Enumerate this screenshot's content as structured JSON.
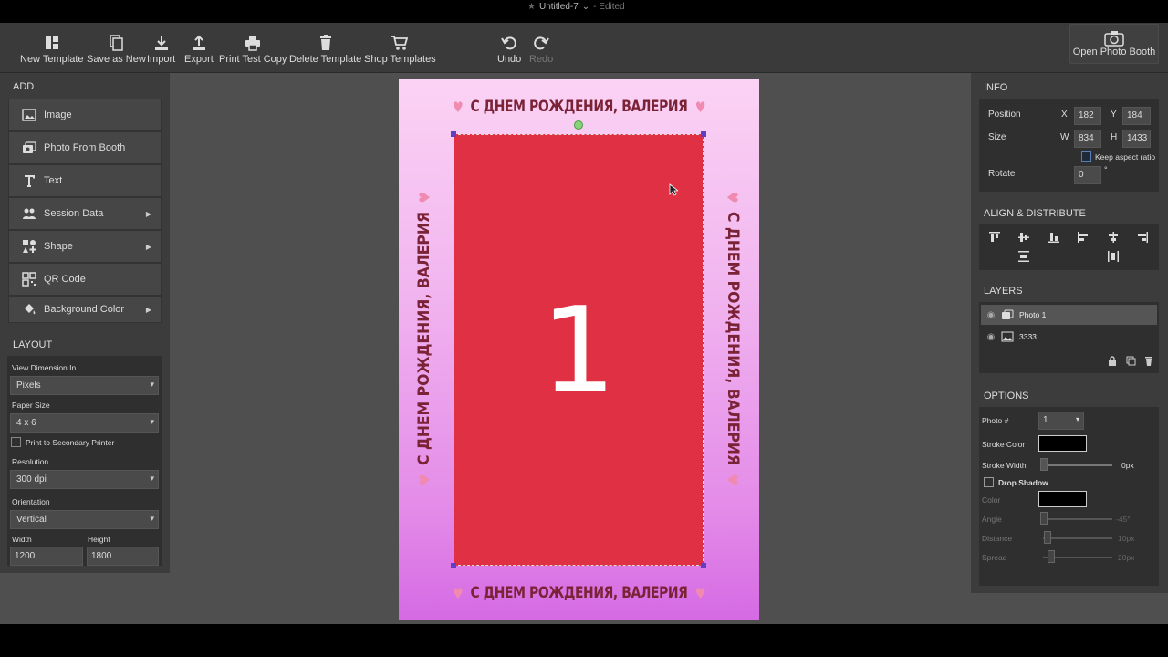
{
  "document": {
    "title": "Untitled-7",
    "status": "- Edited"
  },
  "toolbar": {
    "new_template": "New Template",
    "save_as_new": "Save as New",
    "import": "Import",
    "export": "Export",
    "print_test_copy": "Print Test Copy",
    "delete_template": "Delete Template",
    "shop_templates": "Shop Templates",
    "undo": "Undo",
    "redo": "Redo",
    "open_photo_booth": "Open Photo Booth"
  },
  "add_panel": {
    "heading": "ADD",
    "items": [
      {
        "label": "Image",
        "icon": "image-icon",
        "submenu": false
      },
      {
        "label": "Photo From Booth",
        "icon": "camera-stack-icon",
        "submenu": false
      },
      {
        "label": "Text",
        "icon": "text-icon",
        "submenu": false
      },
      {
        "label": "Session Data",
        "icon": "people-icon",
        "submenu": true
      },
      {
        "label": "Shape",
        "icon": "shapes-icon",
        "submenu": true
      },
      {
        "label": "QR Code",
        "icon": "qr-icon",
        "submenu": false
      },
      {
        "label": "Background Color",
        "icon": "paint-bucket-icon",
        "submenu": true
      }
    ]
  },
  "layout_panel": {
    "heading": "LAYOUT",
    "view_dimension_label": "View Dimension In",
    "view_dimension_value": "Pixels",
    "paper_size_label": "Paper Size",
    "paper_size_value": "4 x 6",
    "secondary_printer_label": "Print to Secondary Printer",
    "resolution_label": "Resolution",
    "resolution_value": "300 dpi",
    "orientation_label": "Orientation",
    "orientation_value": "Vertical",
    "width_label": "Width",
    "width_value": "1200",
    "height_label": "Height",
    "height_value": "1800"
  },
  "info_panel": {
    "heading": "INFO",
    "position_label": "Position",
    "x_label": "X",
    "x_value": "182",
    "y_label": "Y",
    "y_value": "184",
    "size_label": "Size",
    "w_label": "W",
    "w_value": "834",
    "h_label": "H",
    "h_value": "1433",
    "keep_aspect_label": "Keep aspect ratio",
    "rotate_label": "Rotate",
    "rotate_value": "0",
    "degree_sign": "°"
  },
  "align_panel": {
    "heading": "ALIGN & DISTRIBUTE"
  },
  "layers_panel": {
    "heading": "LAYERS",
    "layers": [
      {
        "name": "Photo 1",
        "selected": true
      },
      {
        "name": "3333",
        "selected": false
      }
    ]
  },
  "options_panel": {
    "heading": "OPTIONS",
    "photo_num_label": "Photo #",
    "photo_num_value": "1",
    "stroke_color_label": "Stroke Color",
    "stroke_width_label": "Stroke Width",
    "stroke_width_value": "0px",
    "drop_shadow_label": "Drop Shadow",
    "color_label": "Color",
    "angle_label": "Angle",
    "angle_value": "-45°",
    "distance_label": "Distance",
    "distance_value": "10px",
    "spread_label": "Spread",
    "spread_value": "20px"
  },
  "canvas": {
    "banner_text": "С ДНЕМ РОЖДЕНИЯ, ВАЛЕРИЯ",
    "heart": "♥",
    "photo_number": "1",
    "photo_color": "#e03043"
  }
}
